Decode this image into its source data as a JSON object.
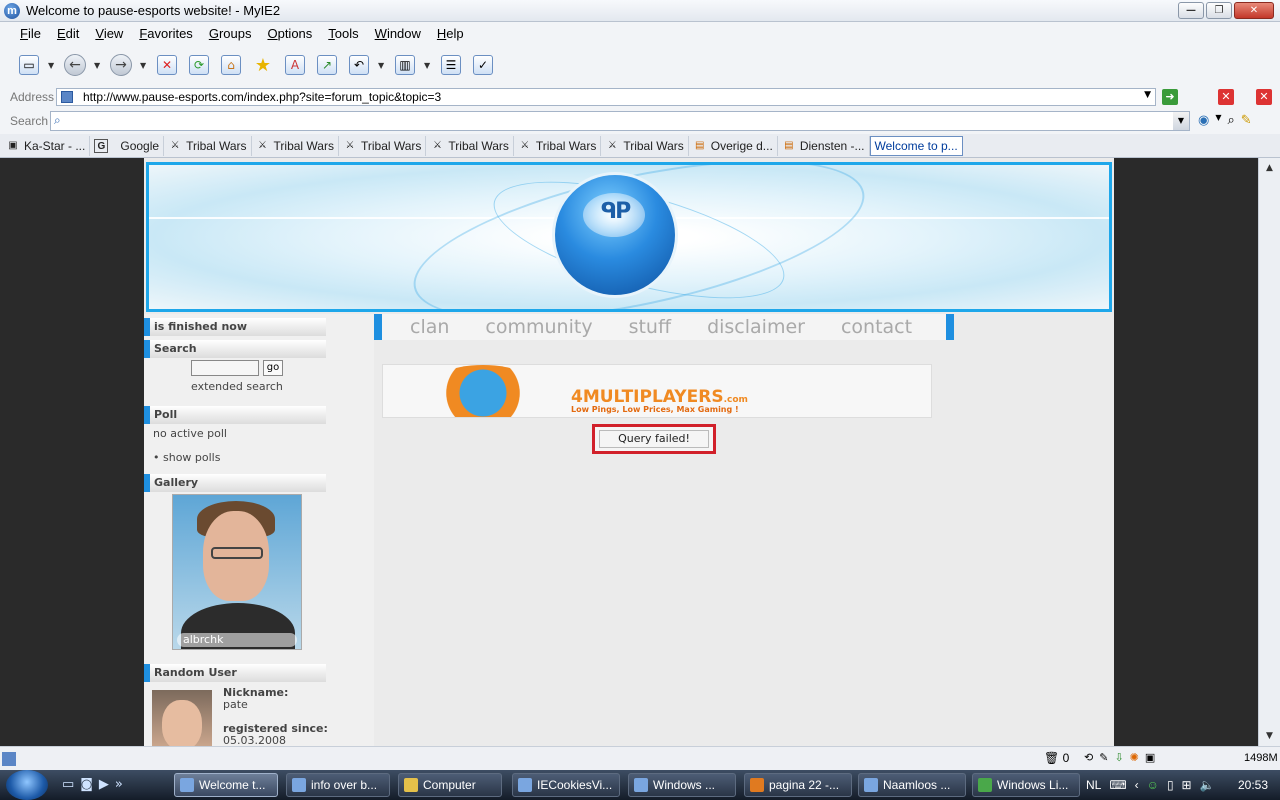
{
  "window": {
    "title": "Welcome to pause-esports website! - MyIE2"
  },
  "menu": [
    "File",
    "Edit",
    "View",
    "Favorites",
    "Groups",
    "Options",
    "Tools",
    "Window",
    "Help"
  ],
  "address": {
    "label": "Address",
    "url": "http://www.pause-esports.com/index.php?site=forum_topic&topic=3"
  },
  "search": {
    "label": "Search",
    "value": ""
  },
  "tabs": [
    {
      "label": "Ka-Star - ...",
      "icon": "ka-star-icon"
    },
    {
      "label": "Google",
      "icon": "google-icon"
    },
    {
      "label": "Tribal Wars",
      "icon": "tribal-wars-icon"
    },
    {
      "label": "Tribal Wars",
      "icon": "tribal-wars-icon"
    },
    {
      "label": "Tribal Wars",
      "icon": "tribal-wars-icon"
    },
    {
      "label": "Tribal Wars",
      "icon": "tribal-wars-icon"
    },
    {
      "label": "Tribal Wars",
      "icon": "tribal-wars-icon"
    },
    {
      "label": "Tribal Wars",
      "icon": "tribal-wars-icon"
    },
    {
      "label": "Overige d...",
      "icon": "page-icon"
    },
    {
      "label": "Diensten -...",
      "icon": "page-icon"
    },
    {
      "label": "Welcome to p...",
      "icon": "none",
      "active": true
    }
  ],
  "site": {
    "nav": [
      "clan",
      "community",
      "stuff",
      "disclaimer",
      "contact"
    ],
    "sidebar": {
      "news_head": "is finished now",
      "search_head": "Search",
      "search_go": "go",
      "extended_search": "extended search",
      "poll_head": "Poll",
      "poll_text": "no active poll",
      "show_polls": "• show polls",
      "gallery_head": "Gallery",
      "gallery_caption": "albrchk",
      "random_user_head": "Random User",
      "nickname_label": "Nickname:",
      "nickname": "pate",
      "registered_label": "registered since:",
      "registered": "05.03.2008"
    },
    "ad": {
      "brand": "4MULTIPLAYERS",
      "brand_suffix": ".com",
      "tagline": "Low Pings, Low Prices, Max Gaming !"
    },
    "error": "Query failed!"
  },
  "statusbar": {
    "count": "0",
    "memory": "1498M"
  },
  "taskbar": {
    "tasks": [
      {
        "label": "Welcome t...",
        "active": true
      },
      {
        "label": "info over b..."
      },
      {
        "label": "Computer"
      },
      {
        "label": "IECookiesVi..."
      },
      {
        "label": "Windows ..."
      },
      {
        "label": "pagina 22 -..."
      },
      {
        "label": "Naamloos ..."
      },
      {
        "label": "Windows Li..."
      }
    ],
    "language": "NL",
    "clock": "20:53"
  }
}
